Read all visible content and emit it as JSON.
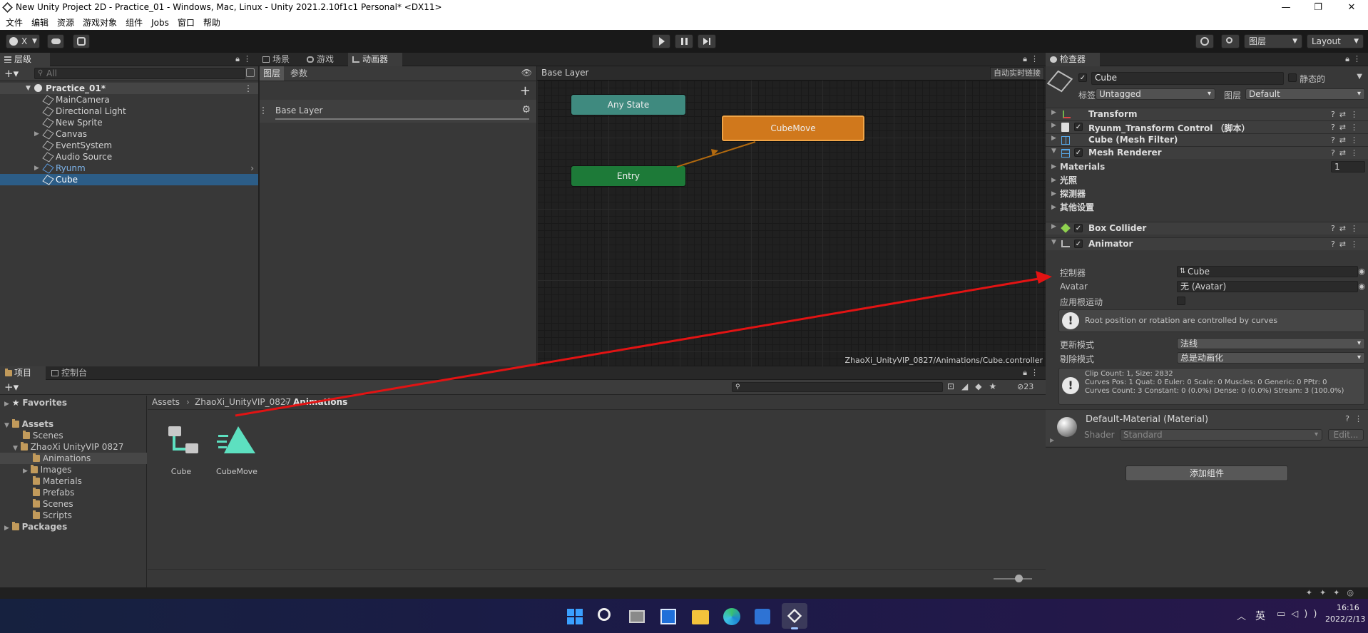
{
  "window": {
    "title": "New Unity Project 2D - Practice_01 - Windows, Mac, Linux - Unity 2021.2.10f1c1 Personal* <DX11>",
    "controls": [
      "—",
      "❐",
      "✕"
    ]
  },
  "menu": [
    "文件",
    "编辑",
    "资源",
    "游戏对象",
    "组件",
    "Jobs",
    "窗口",
    "帮助"
  ],
  "toolbar": {
    "account": "X",
    "layers_label": "图层",
    "layout_label": "Layout"
  },
  "hierarchy": {
    "tab": "层级",
    "search_placeholder": "All",
    "scene": "Practice_01*",
    "items": [
      {
        "name": "MainCamera"
      },
      {
        "name": "Directional Light"
      },
      {
        "name": "New Sprite"
      },
      {
        "name": "Canvas"
      },
      {
        "name": "EventSystem"
      },
      {
        "name": "Audio Source"
      },
      {
        "name": "Ryunm"
      },
      {
        "name": "Cube"
      }
    ]
  },
  "center_tabs": [
    "场景",
    "游戏",
    "动画器"
  ],
  "animator": {
    "subtabs": [
      "图层",
      "参数"
    ],
    "layer_name": "Base Layer",
    "breadcrumb": "Base Layer",
    "auto_live": "自动实时链接",
    "nodes": {
      "any": "Any State",
      "entry": "Entry",
      "move": "CubeMove"
    },
    "path": "ZhaoXi_UnityVIP_0827/Animations/Cube.controller"
  },
  "inspector": {
    "tab": "检查器",
    "object_name": "Cube",
    "static_label": "静态的",
    "tag_label": "标签",
    "tag_value": "Untagged",
    "layer_label": "图层",
    "layer_value": "Default",
    "components": {
      "transform": "Transform",
      "script": "Ryunm_Transform Control （脚本）",
      "meshfilter": "Cube (Mesh Filter)",
      "meshrenderer": "Mesh Renderer",
      "boxcollider": "Box Collider",
      "animator": "Animator"
    },
    "mesh_renderer": {
      "materials": "Materials",
      "materials_count": "1",
      "lighting": "光照",
      "probes": "探测器",
      "other": "其他设置"
    },
    "animator_fields": {
      "controller_label": "控制器",
      "controller_value": "Cube",
      "avatar_label": "Avatar",
      "avatar_value": "无 (Avatar)",
      "root_motion_label": "应用根运动",
      "root_note": "Root position or rotation are controlled by curves",
      "update_label": "更新模式",
      "update_value": "法线",
      "culling_label": "剔除模式",
      "culling_value": "总是动画化",
      "info1": "Clip Count: 1, Size: 2832",
      "info2": "Curves Pos: 1 Quat: 0 Euler: 0 Scale: 0 Muscles: 0 Generic: 0 PPtr: 0",
      "info3": "Curves Count: 3 Constant: 0 (0.0%) Dense: 0 (0.0%) Stream: 3 (100.0%)"
    },
    "material": {
      "name": "Default-Material (Material)",
      "shader_label": "Shader",
      "shader_value": "Standard",
      "edit": "Edit..."
    },
    "add_component": "添加组件"
  },
  "project": {
    "tabs": [
      "项目",
      "控制台"
    ],
    "hidden_count": "23",
    "tree": {
      "favorites": "Favorites",
      "assets": "Assets",
      "scenes": "Scenes",
      "zhaoxi": "ZhaoXi UnityVIP 0827",
      "animations": "Animations",
      "images": "Images",
      "materials": "Materials",
      "prefabs": "Prefabs",
      "scenes2": "Scenes",
      "scripts": "Scripts",
      "packages": "Packages"
    },
    "breadcrumb": [
      "Assets",
      "ZhaoXi_UnityVIP_0827",
      "Animations"
    ],
    "assets_items": [
      {
        "label": "Cube"
      },
      {
        "label": "CubeMove"
      }
    ]
  },
  "taskbar": {
    "ime": "英",
    "time": "16:16",
    "date": "2022/2/13"
  },
  "colors": {
    "accent_red": "#e21313",
    "entry_green": "#1d7a38",
    "any_teal": "#3f8a7f",
    "state_orange": "#d0781c",
    "selection": "#2c5d87"
  }
}
